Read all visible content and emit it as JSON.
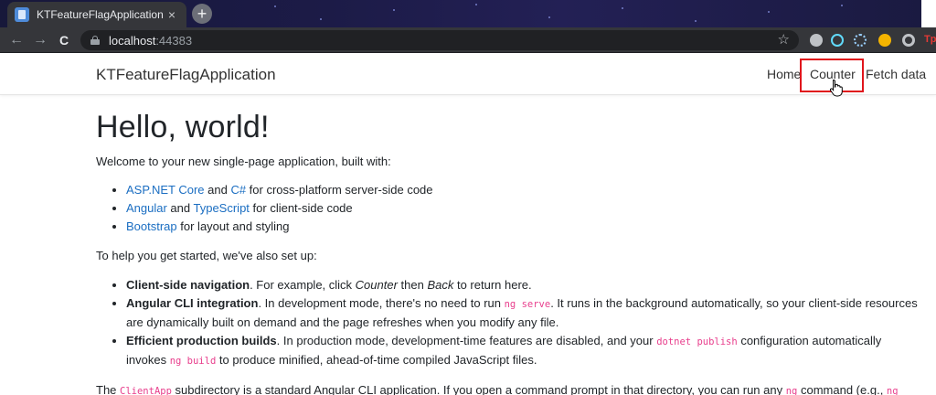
{
  "browser": {
    "tab_title": "KTFeatureFlagApplication",
    "tab_close_glyph": "×",
    "new_tab_glyph": "+",
    "url_host": "localhost",
    "url_port": ":44383",
    "back_glyph": "←",
    "forward_glyph": "→",
    "reload_glyph": "C",
    "bookmark_glyph": "☆",
    "extensions": [
      "extension-icon",
      "react-devtools-icon",
      "redux-devtools-icon",
      "color-picker-icon",
      "record-icon"
    ],
    "partial_extension_text": "Tp"
  },
  "app": {
    "brand": "KTFeatureFlagApplication",
    "nav": {
      "home": "Home",
      "counter": "Counter",
      "fetch": "Fetch data"
    }
  },
  "page": {
    "heading": "Hello, world!",
    "intro": "Welcome to your new single-page application, built with:",
    "tech": [
      {
        "link1": "ASP.NET Core",
        "mid": " and ",
        "link2": "C#",
        "rest": " for cross-platform server-side code"
      },
      {
        "link1": "Angular",
        "mid": " and ",
        "link2": "TypeScript",
        "rest": " for client-side code"
      },
      {
        "link1": "Bootstrap",
        "rest": " for layout and styling"
      }
    ],
    "setup_intro": "To help you get started, we've also set up:",
    "features": [
      {
        "bold": "Client-side navigation",
        "t1": ". For example, click ",
        "em1": "Counter",
        "t2": " then ",
        "em2": "Back",
        "t3": " to return here."
      },
      {
        "bold": "Angular CLI integration",
        "t1": ". In development mode, there's no need to run ",
        "code1": "ng serve",
        "t2": ". It runs in the background automatically, so your client-side resources are dynamically built on demand and the page refreshes when you modify any file."
      },
      {
        "bold": "Efficient production builds",
        "t1": ". In production mode, development-time features are disabled, and your ",
        "code1": "dotnet publish",
        "t2": " configuration automatically invokes ",
        "code2": "ng build",
        "t3": " to produce minified, ahead-of-time compiled JavaScript files."
      }
    ],
    "clientapp": {
      "t1": "The ",
      "code1": "ClientApp",
      "t2": " subdirectory is a standard Angular CLI application. If you open a command prompt in that directory, you can run any ",
      "code2": "ng",
      "t3": " command (e.g., ",
      "code3": "ng"
    }
  },
  "colors": {
    "link": "#1b6ec2",
    "code": "#e83e8c",
    "highlight": "#e0151c"
  }
}
